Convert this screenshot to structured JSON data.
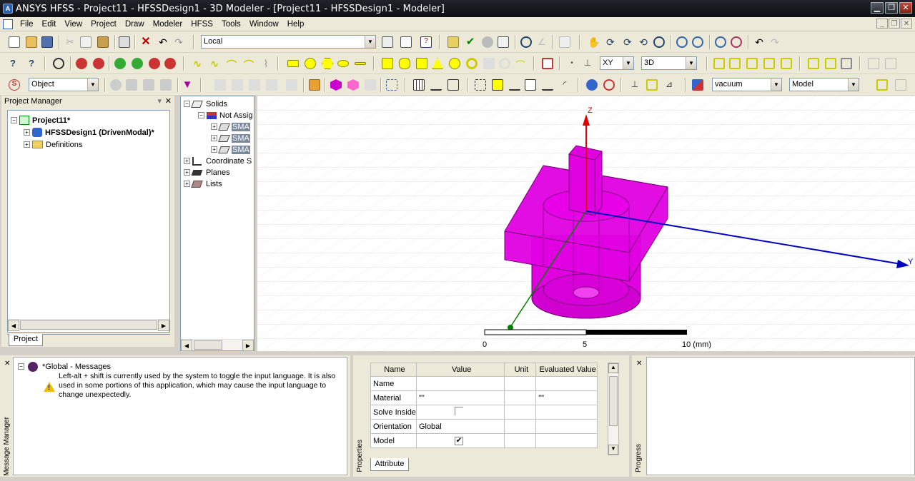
{
  "window": {
    "title": "ANSYS HFSS - Project11 - HFSSDesign1 - 3D Modeler - [Project11 - HFSSDesign1 - Modeler]"
  },
  "menu": [
    "File",
    "Edit",
    "View",
    "Project",
    "Draw",
    "Modeler",
    "HFSS",
    "Tools",
    "Window",
    "Help"
  ],
  "toolbar": {
    "cs_combo": "Local",
    "plane_combo": "XY",
    "dim_combo": "3D",
    "select_combo": "Object",
    "material_combo": "vacuum",
    "model_combo": "Model"
  },
  "project_manager": {
    "title": "Project Manager",
    "project": "Project11*",
    "design": "HFSSDesign1 (DrivenModal)*",
    "definitions": "Definitions",
    "tab": "Project"
  },
  "model_tree": {
    "solids": "Solids",
    "not_assigned": "Not Assig",
    "objects": [
      "SMA",
      "SMA",
      "SMA"
    ],
    "coordinate": "Coordinate S",
    "planes": "Planes",
    "lists": "Lists"
  },
  "viewport": {
    "axis_z": "Z",
    "axis_y": "Y",
    "scale": {
      "t0": "0",
      "t1": "5",
      "t2": "10 (mm)"
    }
  },
  "messages": {
    "panel_label": "Message Manager",
    "header": "*Global - Messages",
    "warning": "Left-alt + shift is currently used by the system to toggle the input language. It is also used in some portions of this application, which may cause the input language to change unexpectedly."
  },
  "properties": {
    "panel_label": "Properties",
    "columns": [
      "Name",
      "Value",
      "Unit",
      "Evaluated Value"
    ],
    "rows": [
      {
        "name": "Name",
        "value": "",
        "unit": "",
        "eval": ""
      },
      {
        "name": "Material",
        "value": "\"\"",
        "unit": "",
        "eval": "\"\""
      },
      {
        "name": "Solve Inside",
        "value": "",
        "unit": "",
        "eval": ""
      },
      {
        "name": "Orientation",
        "value": "Global",
        "unit": "",
        "eval": ""
      },
      {
        "name": "Model",
        "value": "",
        "unit": "",
        "eval": ""
      }
    ],
    "tab": "Attribute"
  },
  "progress": {
    "panel_label": "Progress"
  },
  "colors": {
    "model": "#e000e0",
    "axis_z": "#e00000",
    "axis_y": "#0000c0",
    "axis_x": "#008000"
  }
}
